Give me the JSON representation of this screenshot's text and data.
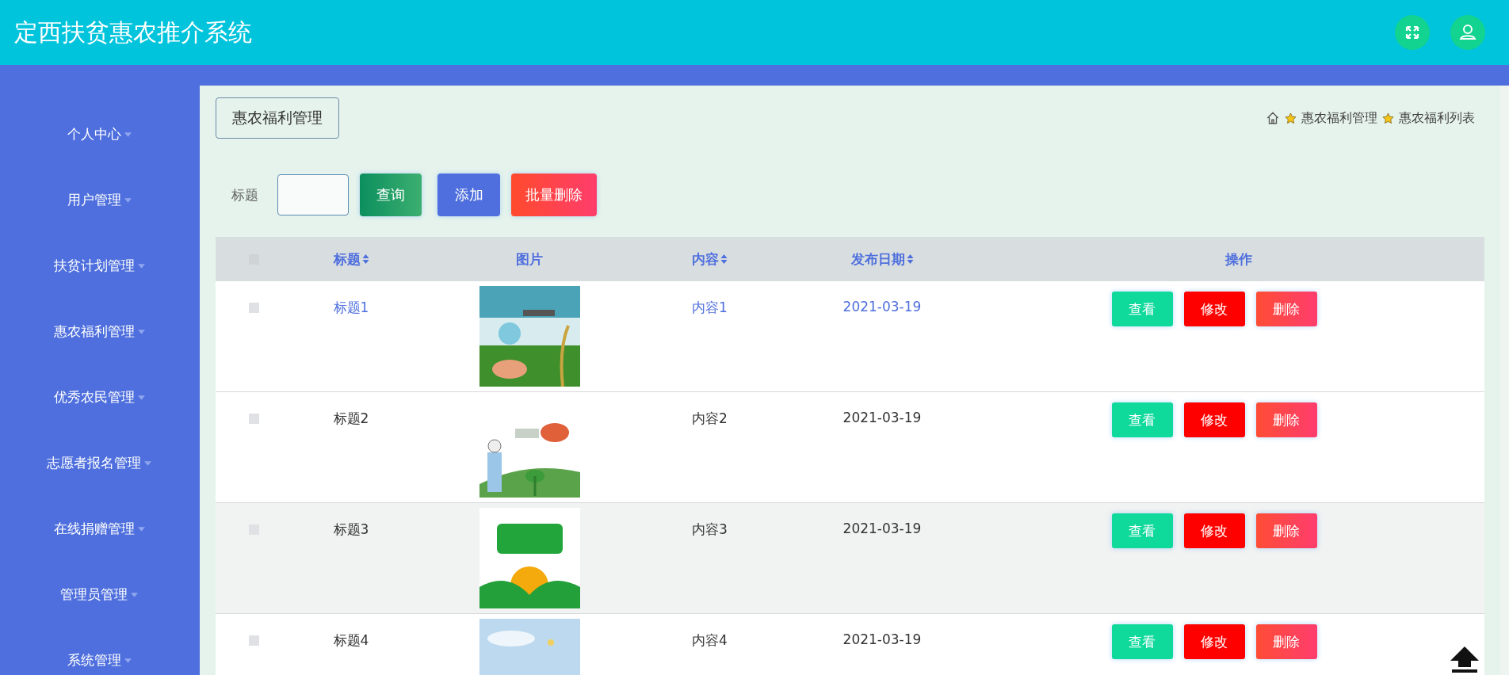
{
  "header": {
    "title": "定西扶贫惠农推介系统"
  },
  "sidebar": {
    "items": [
      {
        "label": "个人中心"
      },
      {
        "label": "用户管理"
      },
      {
        "label": "扶贫计划管理"
      },
      {
        "label": "惠农福利管理"
      },
      {
        "label": "优秀农民管理"
      },
      {
        "label": "志愿者报名管理"
      },
      {
        "label": "在线捐赠管理"
      },
      {
        "label": "管理员管理"
      },
      {
        "label": "系统管理"
      }
    ]
  },
  "page_title": "惠农福利管理",
  "breadcrumb": [
    "惠农福利管理",
    "惠农福利列表"
  ],
  "search": {
    "label": "标题"
  },
  "buttons": [
    {
      "label": "查询",
      "kind": "search"
    },
    {
      "label": "添加",
      "kind": "add"
    },
    {
      "label": "批量删除",
      "kind": "delete"
    }
  ],
  "table": {
    "select_all_checked": false,
    "columns": [
      {
        "label": "标题",
        "sortable": true
      },
      {
        "label": "图片",
        "sortable": false
      },
      {
        "label": "内容",
        "sortable": true
      },
      {
        "label": "发布日期",
        "sortable": true
      },
      {
        "label": "操作",
        "sortable": false
      }
    ],
    "rows": [
      {
        "title": "标题1",
        "picture": {
          "kind": "picture"
        },
        "content": "内容1",
        "date": "2021-03-19",
        "checked": false,
        "highlighted": true,
        "shaded": false,
        "actions": [
          {
            "label": "查看",
            "kind": "view"
          },
          {
            "label": "修改",
            "kind": "edit"
          },
          {
            "label": "删除",
            "kind": "delete"
          }
        ]
      },
      {
        "title": "标题2",
        "picture": {
          "kind": "picture"
        },
        "content": "内容2",
        "date": "2021-03-19",
        "checked": false,
        "highlighted": false,
        "shaded": false,
        "actions": [
          {
            "label": "查看",
            "kind": "view"
          },
          {
            "label": "修改",
            "kind": "edit"
          },
          {
            "label": "删除",
            "kind": "delete"
          }
        ]
      },
      {
        "title": "标题3",
        "picture": {
          "kind": "picture"
        },
        "content": "内容3",
        "date": "2021-03-19",
        "checked": false,
        "highlighted": false,
        "shaded": true,
        "actions": [
          {
            "label": "查看",
            "kind": "view"
          },
          {
            "label": "修改",
            "kind": "edit"
          },
          {
            "label": "删除",
            "kind": "delete"
          }
        ]
      },
      {
        "title": "标题4",
        "picture": {
          "kind": "picture"
        },
        "content": "内容4",
        "date": "2021-03-19",
        "checked": false,
        "highlighted": false,
        "shaded": false,
        "actions": [
          {
            "label": "查看",
            "kind": "view"
          },
          {
            "label": "修改",
            "kind": "edit"
          },
          {
            "label": "删除",
            "kind": "delete"
          }
        ]
      }
    ]
  }
}
